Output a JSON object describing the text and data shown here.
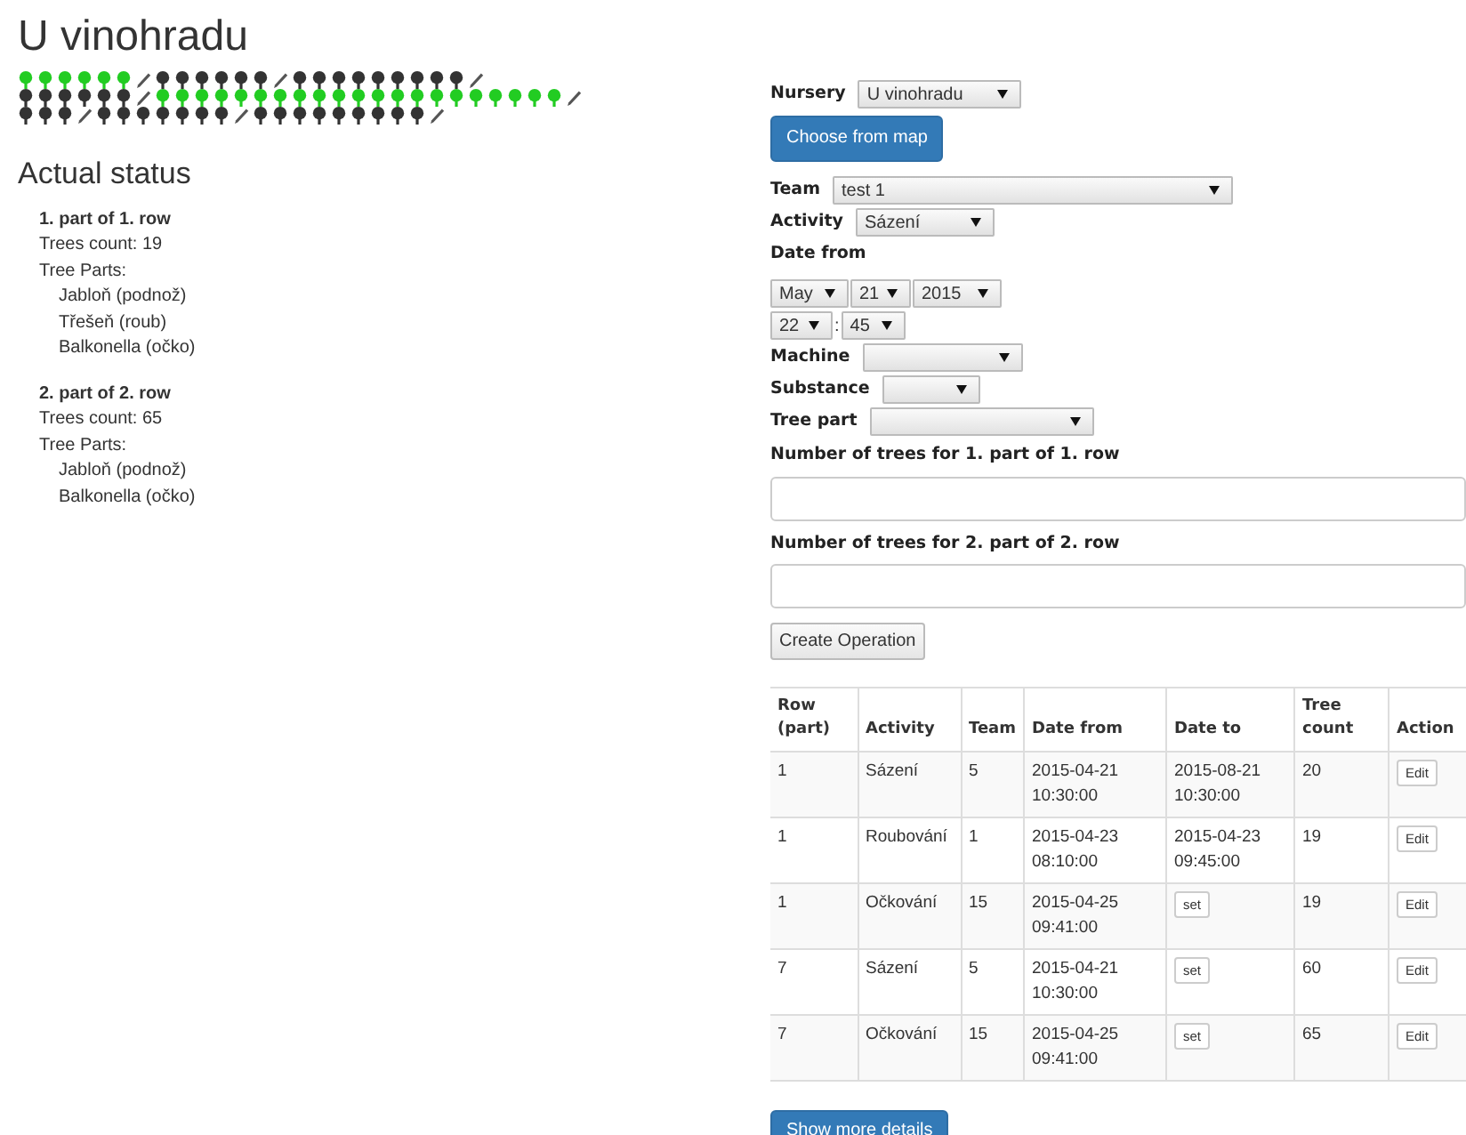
{
  "title": "U vinohradu",
  "tree_map": [
    {
      "items": [
        {
          "kind": "tree",
          "selected": true
        },
        {
          "kind": "tree",
          "selected": true
        },
        {
          "kind": "tree",
          "selected": true
        },
        {
          "kind": "tree",
          "selected": true
        },
        {
          "kind": "tree",
          "selected": true
        },
        {
          "kind": "tree",
          "selected": true
        },
        {
          "kind": "pencil"
        },
        {
          "kind": "tree",
          "selected": false
        },
        {
          "kind": "tree",
          "selected": false
        },
        {
          "kind": "tree",
          "selected": false
        },
        {
          "kind": "tree",
          "selected": false
        },
        {
          "kind": "tree",
          "selected": false
        },
        {
          "kind": "tree",
          "selected": false
        },
        {
          "kind": "pencil"
        },
        {
          "kind": "tree",
          "selected": false
        },
        {
          "kind": "tree",
          "selected": false
        },
        {
          "kind": "tree",
          "selected": false
        },
        {
          "kind": "tree",
          "selected": false
        },
        {
          "kind": "tree",
          "selected": false
        },
        {
          "kind": "tree",
          "selected": false
        },
        {
          "kind": "tree",
          "selected": false
        },
        {
          "kind": "tree",
          "selected": false
        },
        {
          "kind": "tree",
          "selected": false
        },
        {
          "kind": "pencil"
        }
      ]
    },
    {
      "items": [
        {
          "kind": "tree",
          "selected": false
        },
        {
          "kind": "tree",
          "selected": false
        },
        {
          "kind": "tree",
          "selected": false
        },
        {
          "kind": "tree",
          "selected": false
        },
        {
          "kind": "tree",
          "selected": false
        },
        {
          "kind": "tree",
          "selected": false
        },
        {
          "kind": "pencil"
        },
        {
          "kind": "tree",
          "selected": true
        },
        {
          "kind": "tree",
          "selected": true
        },
        {
          "kind": "tree",
          "selected": true
        },
        {
          "kind": "tree",
          "selected": true
        },
        {
          "kind": "tree",
          "selected": true
        },
        {
          "kind": "tree",
          "selected": true
        },
        {
          "kind": "tree",
          "selected": true
        },
        {
          "kind": "tree",
          "selected": true
        },
        {
          "kind": "tree",
          "selected": true
        },
        {
          "kind": "tree",
          "selected": true
        },
        {
          "kind": "tree",
          "selected": true
        },
        {
          "kind": "tree",
          "selected": true
        },
        {
          "kind": "tree",
          "selected": true
        },
        {
          "kind": "tree",
          "selected": true
        },
        {
          "kind": "tree",
          "selected": true
        },
        {
          "kind": "tree",
          "selected": true
        },
        {
          "kind": "tree",
          "selected": true
        },
        {
          "kind": "tree",
          "selected": true
        },
        {
          "kind": "tree",
          "selected": true
        },
        {
          "kind": "tree",
          "selected": true
        },
        {
          "kind": "tree",
          "selected": true
        },
        {
          "kind": "pencil"
        }
      ]
    },
    {
      "items": [
        {
          "kind": "tree",
          "selected": false
        },
        {
          "kind": "tree",
          "selected": false
        },
        {
          "kind": "tree",
          "selected": false
        },
        {
          "kind": "pencil"
        },
        {
          "kind": "tree",
          "selected": false
        },
        {
          "kind": "tree",
          "selected": false
        },
        {
          "kind": "tree",
          "selected": false
        },
        {
          "kind": "tree",
          "selected": false
        },
        {
          "kind": "tree",
          "selected": false
        },
        {
          "kind": "tree",
          "selected": false
        },
        {
          "kind": "tree",
          "selected": false
        },
        {
          "kind": "pencil"
        },
        {
          "kind": "tree",
          "selected": false
        },
        {
          "kind": "tree",
          "selected": false
        },
        {
          "kind": "tree",
          "selected": false
        },
        {
          "kind": "tree",
          "selected": false
        },
        {
          "kind": "tree",
          "selected": false
        },
        {
          "kind": "tree",
          "selected": false
        },
        {
          "kind": "tree",
          "selected": false
        },
        {
          "kind": "tree",
          "selected": false
        },
        {
          "kind": "tree",
          "selected": false
        },
        {
          "kind": "pencil"
        }
      ]
    }
  ],
  "status": {
    "heading": "Actual status",
    "parts": [
      {
        "title": "1. part of 1. row",
        "count": "Trees count: 19",
        "parts_label": "Tree Parts:",
        "tree_parts": [
          "Jabloň (podnož)",
          "Třešeň (roub)",
          "Balkonella (očko)"
        ]
      },
      {
        "title": "2. part of 2. row",
        "count": "Trees count: 65",
        "parts_label": "Tree Parts:",
        "tree_parts": [
          "Jabloň (podnož)",
          "Balkonella (očko)"
        ]
      }
    ]
  },
  "form": {
    "nursery": {
      "label": "Nursery",
      "value": "U vinohradu"
    },
    "map_button": "Choose from map",
    "team": {
      "label": "Team",
      "value": "test 1"
    },
    "activity": {
      "label": "Activity",
      "value": "Sázení"
    },
    "date_from": {
      "label": "Date from",
      "month": "May",
      "day": "21",
      "year": "2015",
      "hour": "22",
      "separator": ":",
      "minute": "45"
    },
    "machine": {
      "label": "Machine"
    },
    "substance": {
      "label": "Substance"
    },
    "tree_part": {
      "label": "Tree part"
    },
    "counts": [
      {
        "label": "Number of trees for 1. part of 1. row"
      },
      {
        "label": "Number of trees for 2. part of 2. row"
      }
    ],
    "create_button": "Create Operation"
  },
  "table": {
    "columns": [
      "Row (part)",
      "Activity",
      "Team",
      "Date from",
      "Date to",
      "Tree count",
      "Action"
    ],
    "rows": [
      {
        "row": "1",
        "activity": "Sázení",
        "team": "5",
        "date_from": "2015-04-21 10:30:00",
        "date_to": {
          "kind": "text",
          "text": "2015-08-21 10:30:00"
        },
        "tree_count": "20",
        "action": "Edit"
      },
      {
        "row": "1",
        "activity": "Roubování",
        "team": "1",
        "date_from": "2015-04-23 08:10:00",
        "date_to": {
          "kind": "text",
          "text": "2015-04-23 09:45:00"
        },
        "tree_count": "19",
        "action": "Edit"
      },
      {
        "row": "1",
        "activity": "Očkování",
        "team": "15",
        "date_from": "2015-04-25 09:41:00",
        "date_to": {
          "kind": "button",
          "text": "set"
        },
        "tree_count": "19",
        "action": "Edit"
      },
      {
        "row": "7",
        "activity": "Sázení",
        "team": "5",
        "date_from": "2015-04-21 10:30:00",
        "date_to": {
          "kind": "button",
          "text": "set"
        },
        "tree_count": "60",
        "action": "Edit"
      },
      {
        "row": "7",
        "activity": "Očkování",
        "team": "15",
        "date_from": "2015-04-25 09:41:00",
        "date_to": {
          "kind": "button",
          "text": "set"
        },
        "tree_count": "65",
        "action": "Edit"
      }
    ]
  },
  "details_button": "Show more details"
}
